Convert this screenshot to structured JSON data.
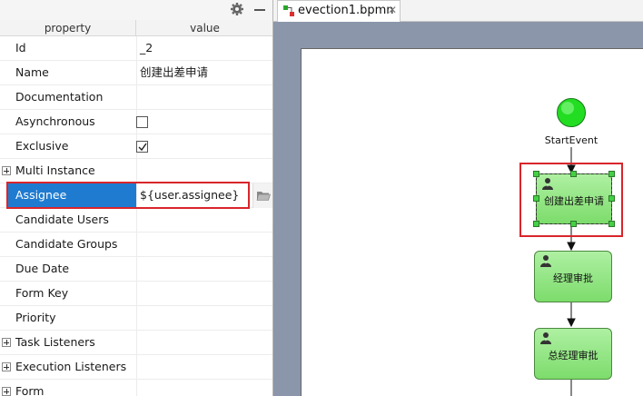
{
  "properties_panel": {
    "header": {
      "property": "property",
      "value": "value"
    },
    "rows": [
      {
        "name": "Id",
        "value": "_2",
        "kind": "text"
      },
      {
        "name": "Name",
        "value": "创建出差申请",
        "kind": "text"
      },
      {
        "name": "Documentation",
        "value": "",
        "kind": "text"
      },
      {
        "name": "Asynchronous",
        "value": "",
        "kind": "checkbox",
        "checked": false
      },
      {
        "name": "Exclusive",
        "value": "",
        "kind": "checkbox",
        "checked": true
      },
      {
        "name": "Multi Instance",
        "value": "",
        "kind": "group"
      },
      {
        "name": "Assignee",
        "value": "${user.assignee}",
        "kind": "text",
        "selected": true
      },
      {
        "name": "Candidate Users",
        "value": "",
        "kind": "text"
      },
      {
        "name": "Candidate Groups",
        "value": "",
        "kind": "text"
      },
      {
        "name": "Due Date",
        "value": "",
        "kind": "text"
      },
      {
        "name": "Form Key",
        "value": "",
        "kind": "text"
      },
      {
        "name": "Priority",
        "value": "",
        "kind": "text"
      },
      {
        "name": "Task Listeners",
        "value": "",
        "kind": "group"
      },
      {
        "name": "Execution Listeners",
        "value": "",
        "kind": "group"
      },
      {
        "name": "Form",
        "value": "",
        "kind": "group"
      }
    ],
    "icons": {
      "settings": "gear-icon",
      "minimize": "minimize-icon",
      "browse": "folder-icon"
    }
  },
  "editor": {
    "tab": {
      "label": "evection1.bpmn",
      "close": "✕",
      "icon": "bpmn-file-icon"
    },
    "diagram": {
      "start_event_label": "StartEvent",
      "tasks": [
        {
          "label": "创建出差申请",
          "selected": true
        },
        {
          "label": "经理审批",
          "selected": false
        },
        {
          "label": "总经理审批",
          "selected": false
        }
      ],
      "colors": {
        "task_fill": "#8be27a",
        "start_fill": "#22dd22",
        "highlight": "#d9252b",
        "selection_row": "#1f7bd0"
      }
    }
  }
}
